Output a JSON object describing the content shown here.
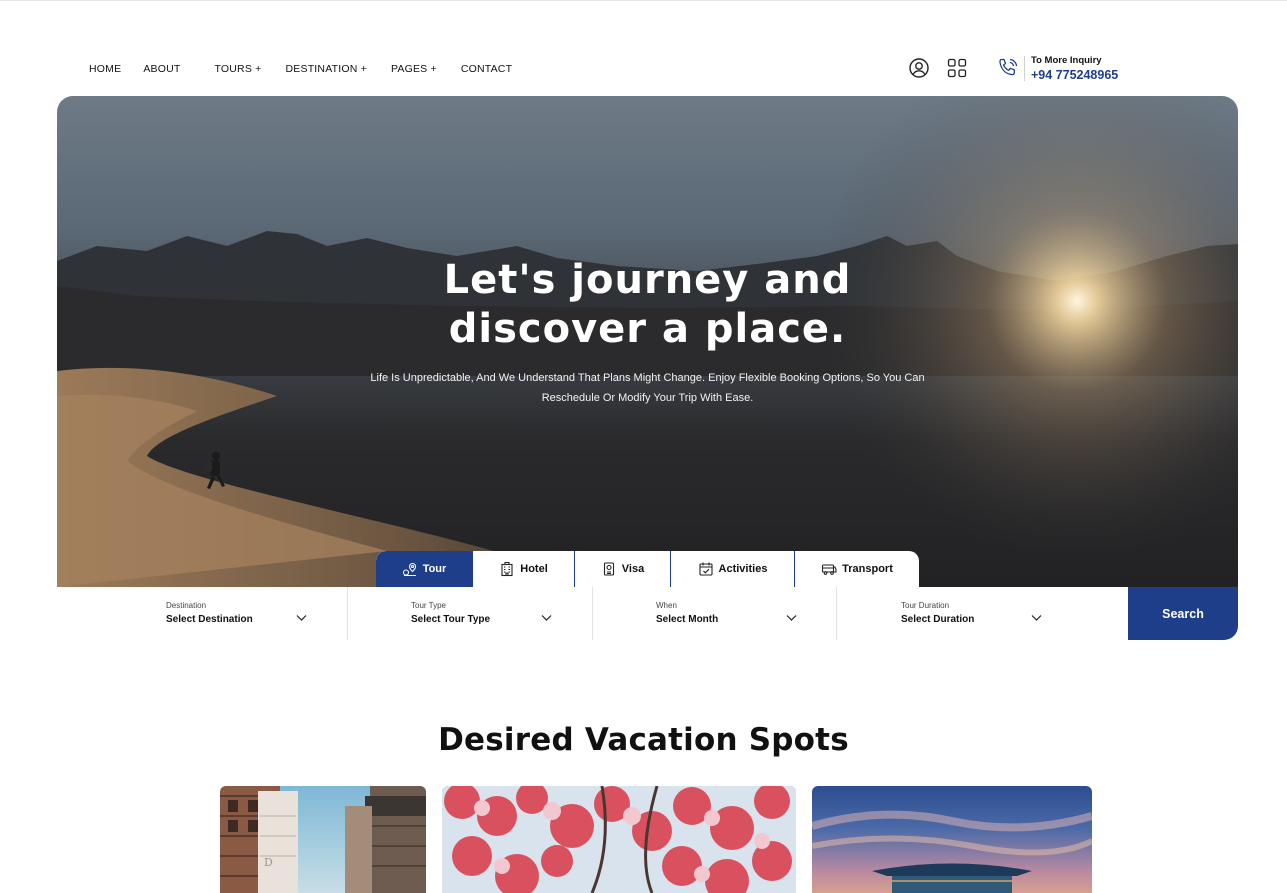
{
  "nav": {
    "items": [
      {
        "label": "HOME"
      },
      {
        "label": "ABOUT"
      },
      {
        "label": "TOURS +"
      },
      {
        "label": "DESTINATION +"
      },
      {
        "label": "PAGES +"
      },
      {
        "label": "CONTACT"
      }
    ]
  },
  "header": {
    "inquiry_label": "To More Inquiry",
    "inquiry_phone": "+94 775248965",
    "icons": [
      "user-circle-icon",
      "grid-icon",
      "phone-icon"
    ]
  },
  "hero": {
    "title_line1": "Let's journey and",
    "title_line2": "discover a place.",
    "subtitle_line1": "Life Is Unpredictable, And We Understand That Plans Might Change. Enjoy Flexible Booking Options, So You Can",
    "subtitle_line2": "Reschedule Or Modify Your Trip With Ease."
  },
  "tabs": [
    {
      "label": "Tour",
      "icon": "tour-pin-icon",
      "active": true
    },
    {
      "label": "Hotel",
      "icon": "hotel-icon",
      "active": false
    },
    {
      "label": "Visa",
      "icon": "passport-icon",
      "active": false
    },
    {
      "label": "Activities",
      "icon": "calendar-icon",
      "active": false
    },
    {
      "label": "Transport",
      "icon": "bus-icon",
      "active": false
    }
  ],
  "search": {
    "fields": [
      {
        "label": "Destination",
        "value": "Select Destination"
      },
      {
        "label": "Tour Type",
        "value": "Select Tour Type"
      },
      {
        "label": "When",
        "value": "Select Month"
      },
      {
        "label": "Tour Duration",
        "value": "Select Duration"
      }
    ],
    "button_label": "Search"
  },
  "section": {
    "title": "Desired Vacation Spots"
  },
  "colors": {
    "brand": "#1f3e8a",
    "text": "#111111",
    "white": "#ffffff"
  }
}
